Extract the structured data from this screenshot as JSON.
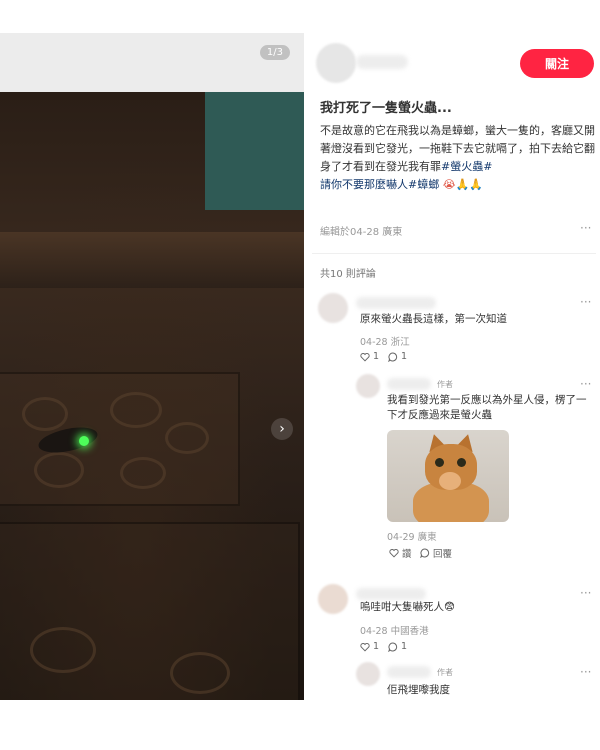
{
  "media": {
    "counter": "1/3"
  },
  "author": {
    "follow_label": "關注"
  },
  "post": {
    "title": "我打死了一隻螢火蟲...",
    "body_plain": "不是故意的它在飛我以為是蟑螂，蠻大一隻的，客廳又開著燈沒看到它發光，一拖鞋下去它就嗝了，拍下去給它翻身了才看到在發光我有罪",
    "tags": [
      "#螢火蟲#",
      "請你不要那麼嚇人#蟑螂"
    ],
    "emojis": "😭🙏🙏",
    "meta": "編輯於04-28 廣東",
    "more": "···"
  },
  "comments_header": "共10 則評論",
  "comments": [
    {
      "text": "原來螢火蟲長這樣，第一次知道",
      "meta": "04-28 浙江",
      "likes": "1",
      "replies": "1",
      "more": "···",
      "reply": {
        "badge": "作者",
        "text": "我看到發光第一反應以為外星人侵，楞了一下才反應過來是螢火蟲",
        "meta": "04-29 廣東",
        "like_label": "讚",
        "reply_label": "回覆",
        "more": "···"
      }
    },
    {
      "text": "嗚哇咁大隻嚇死人😨",
      "meta": "04-28 中國香港",
      "likes": "1",
      "replies": "1",
      "more": "···",
      "reply": {
        "badge": "作者",
        "text": "佢飛埋嚟我度",
        "more": "···"
      }
    }
  ],
  "colors": {
    "accent": "#ff2442",
    "tag": "#13386c",
    "meta": "#999999"
  },
  "icons": [
    "chevron-right-icon",
    "heart-icon",
    "comment-icon"
  ]
}
